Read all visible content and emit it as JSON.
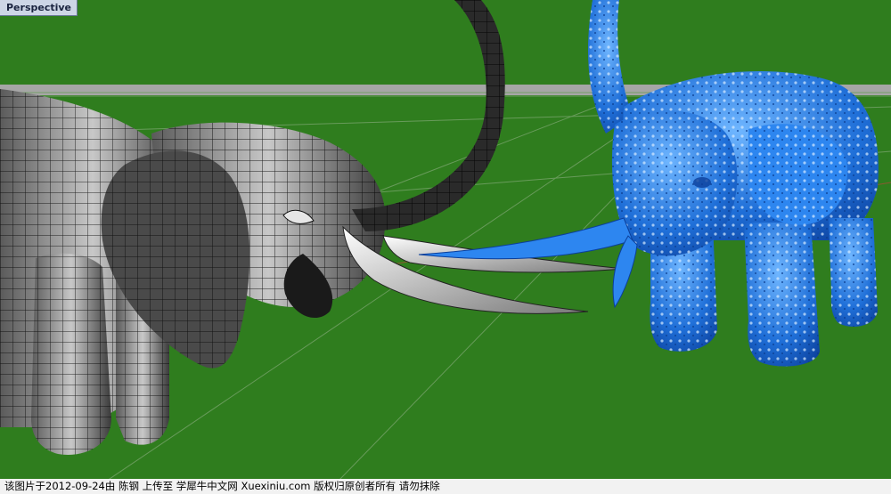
{
  "viewport": {
    "title": "Perspective",
    "background_color": "#2f7d1e",
    "horizon_color": "#9a9a9a"
  },
  "scene": {
    "left_model": {
      "name": "wireframe-elephant",
      "surface_color": "#3a3a3a",
      "mesh_color": "#000000"
    },
    "right_model": {
      "name": "blue-elephant",
      "surface_color": "#1f6fd8"
    }
  },
  "caption": {
    "text": "该图片于2012-09-24由 陈钢 上传至 学犀牛中文网 Xuexiniu.com 版权归原创者所有 请勿抹除"
  }
}
